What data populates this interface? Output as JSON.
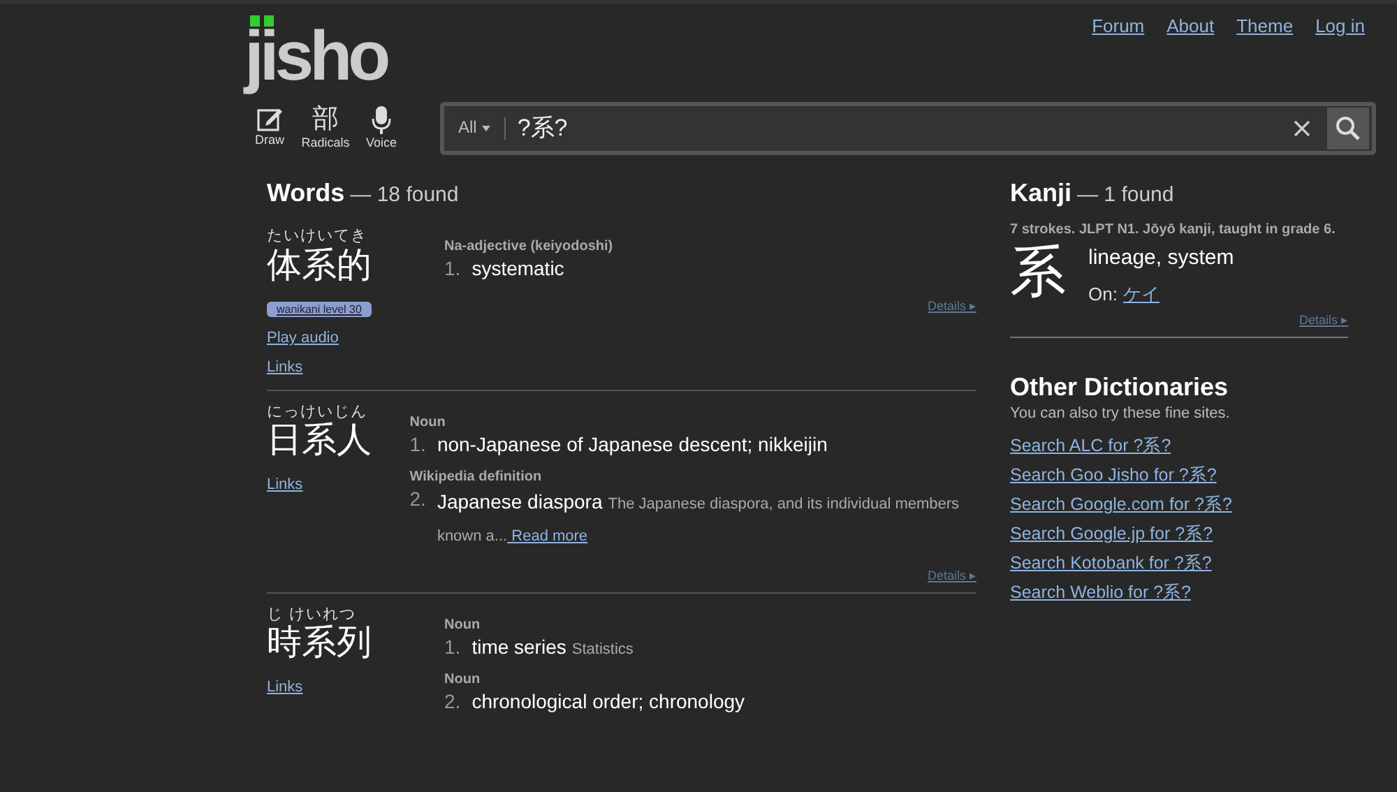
{
  "logo": {
    "text": "jisho"
  },
  "nav_links": [
    "Forum",
    "About",
    "Theme",
    "Log in"
  ],
  "tools": [
    {
      "kind": "draw",
      "label": "Draw"
    },
    {
      "kind": "radicals",
      "glyph": "部",
      "label": "Radicals"
    },
    {
      "kind": "voice",
      "label": "Voice"
    }
  ],
  "search": {
    "scope": "All",
    "value": "?系?"
  },
  "words": {
    "title": "Words",
    "count": "— 18 found",
    "entries": [
      {
        "furigana": "たいけいてき",
        "word": "体系的",
        "badge": "wanikani level 30",
        "links": [
          "Play audio",
          "Links"
        ],
        "senses": [
          {
            "pos": "Na-adjective (keiyodoshi)",
            "number": "1.",
            "meaning": "systematic"
          }
        ],
        "details": "Details ▸"
      },
      {
        "furigana": "にっけいじん",
        "word": "日系人",
        "links": [
          "Links"
        ],
        "senses": [
          {
            "pos": "Noun",
            "number": "1.",
            "meaning": "non-Japanese of Japanese descent; nikkeijin"
          },
          {
            "pos": "Wikipedia definition",
            "number": "2.",
            "meaning": "Japanese diaspora",
            "abstract": "The Japanese diaspora, and its individual members known a...",
            "read_more": " Read more"
          }
        ],
        "details": "Details ▸"
      },
      {
        "furigana": "じ けいれつ",
        "word": "時系列",
        "links": [
          "Links"
        ],
        "senses": [
          {
            "pos": "Noun",
            "number": "1.",
            "meaning": "time series",
            "tag": "Statistics"
          },
          {
            "pos": "Noun",
            "number": "2.",
            "meaning": "chronological order; chronology"
          }
        ]
      }
    ]
  },
  "kanji": {
    "title": "Kanji",
    "count": "— 1 found",
    "info": "7 strokes. JLPT N1. Jōyō kanji, taught in grade 6.",
    "character": "系",
    "meaning": "lineage, system",
    "on_label": "On:",
    "on_reading": "ケイ",
    "details": "Details ▸"
  },
  "other_dictionaries": {
    "title": "Other Dictionaries",
    "subtitle": "You can also try these fine sites.",
    "links": [
      "Search ALC for ?系?",
      "Search Goo Jisho for ?系?",
      "Search Google.com for ?系?",
      "Search Google.jp for ?系?",
      "Search Kotobank for ?系?",
      "Search Weblio for ?系?"
    ]
  }
}
